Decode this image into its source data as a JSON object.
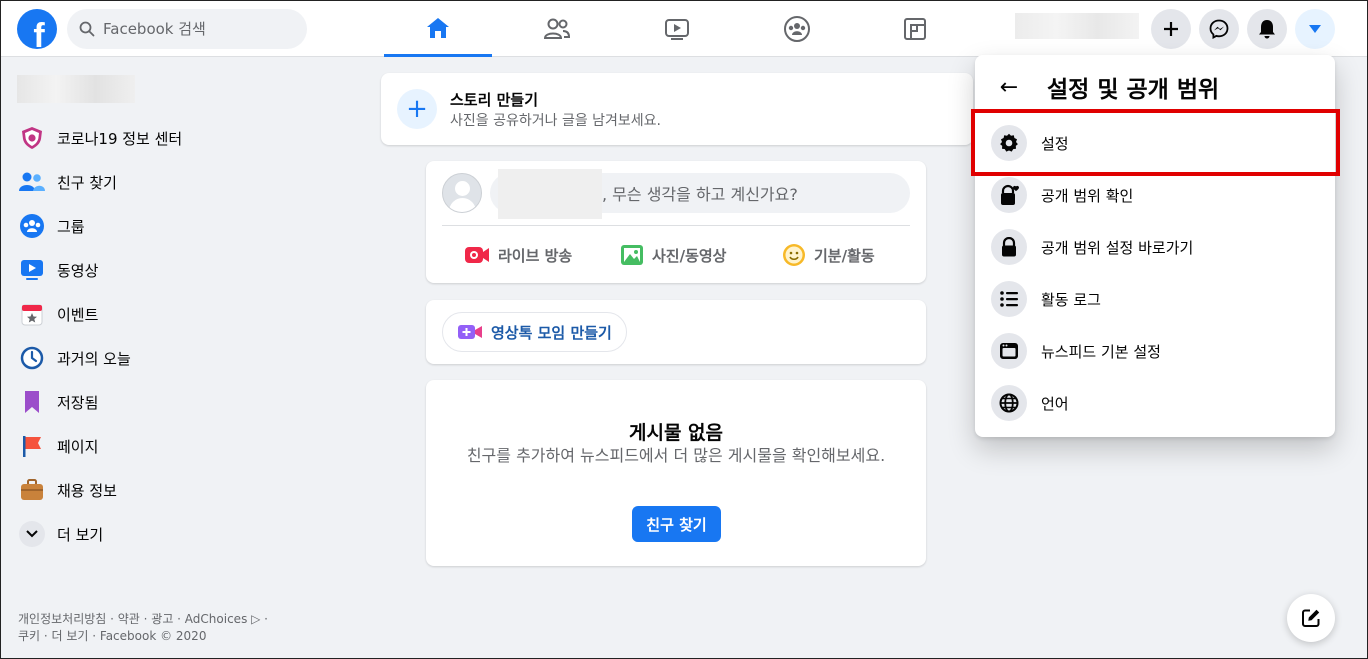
{
  "search": {
    "placeholder": "Facebook 검색"
  },
  "logo": {
    "letter": "f"
  },
  "sidebar": {
    "items": [
      {
        "label": "코로나19 정보 센터",
        "icon": "covid-shield-icon"
      },
      {
        "label": "친구 찾기",
        "icon": "friends-icon"
      },
      {
        "label": "그룹",
        "icon": "groups-icon"
      },
      {
        "label": "동영상",
        "icon": "video-icon"
      },
      {
        "label": "이벤트",
        "icon": "calendar-icon"
      },
      {
        "label": "과거의 오늘",
        "icon": "memories-clock-icon"
      },
      {
        "label": "저장됨",
        "icon": "bookmark-icon"
      },
      {
        "label": "페이지",
        "icon": "flag-icon"
      },
      {
        "label": "채용 정보",
        "icon": "briefcase-icon"
      },
      {
        "label": "더 보기",
        "icon": "chevron-down-icon"
      }
    ],
    "footer_line1": "개인정보처리방침 · 약관 · 광고 · AdChoices ▷ ·",
    "footer_line2": "쿠키 · 더 보기 · Facebook © 2020"
  },
  "story": {
    "title": "스토리 만들기",
    "subtitle": "사진을 공유하거나 글을 남겨보세요.",
    "plus": "+"
  },
  "composer": {
    "prompt": ", 무슨 생각을 하고 계신가요?",
    "actions": [
      "라이브 방송",
      "사진/동영상",
      "기분/활동"
    ]
  },
  "room": {
    "label": "영상톡 모임 만들기"
  },
  "empty": {
    "title": "게시물 없음",
    "description": "친구를 추가하여 뉴스피드에서 더 많은 게시물을 확인해보세요.",
    "button": "친구 찾기"
  },
  "dropdown": {
    "back": "←",
    "title": "설정 및 공개 범위",
    "items": [
      {
        "label": "설정",
        "icon": "gear-icon"
      },
      {
        "label": "공개 범위 확인",
        "icon": "lock-heart-icon"
      },
      {
        "label": "공개 범위 설정 바로가기",
        "icon": "lock-icon"
      },
      {
        "label": "활동 로그",
        "icon": "list-icon"
      },
      {
        "label": "뉴스피드 기본 설정",
        "icon": "feed-icon"
      },
      {
        "label": "언어",
        "icon": "globe-icon"
      }
    ]
  },
  "colors": {
    "brand": "#1877f2",
    "highlight": "#e00000"
  }
}
